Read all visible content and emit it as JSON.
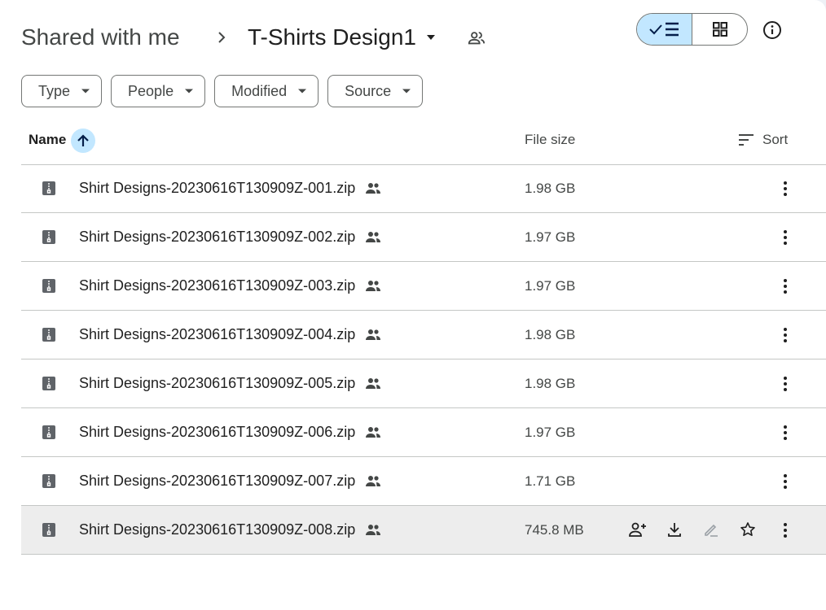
{
  "breadcrumb": {
    "root": "Shared with me",
    "current": "T-Shirts Design1"
  },
  "filters": [
    {
      "label": "Type"
    },
    {
      "label": "People"
    },
    {
      "label": "Modified"
    },
    {
      "label": "Source"
    }
  ],
  "table": {
    "headers": {
      "name": "Name",
      "size": "File size",
      "sort": "Sort"
    },
    "rows": [
      {
        "name": "Shirt Designs-20230616T130909Z-001.zip",
        "size": "1.98 GB"
      },
      {
        "name": "Shirt Designs-20230616T130909Z-002.zip",
        "size": "1.97 GB"
      },
      {
        "name": "Shirt Designs-20230616T130909Z-003.zip",
        "size": "1.97 GB"
      },
      {
        "name": "Shirt Designs-20230616T130909Z-004.zip",
        "size": "1.98 GB"
      },
      {
        "name": "Shirt Designs-20230616T130909Z-005.zip",
        "size": "1.98 GB"
      },
      {
        "name": "Shirt Designs-20230616T130909Z-006.zip",
        "size": "1.97 GB"
      },
      {
        "name": "Shirt Designs-20230616T130909Z-007.zip",
        "size": "1.71 GB"
      },
      {
        "name": "Shirt Designs-20230616T130909Z-008.zip",
        "size": "745.8 MB"
      }
    ]
  },
  "colors": {
    "accent": "#c2e7ff",
    "hover_row": "#ededed",
    "border": "#c4c7c5"
  },
  "icons": [
    "chevron-right-icon",
    "dropdown-caret-icon",
    "shared-people-icon",
    "list-view-icon",
    "grid-view-icon",
    "info-icon",
    "sort-arrow-up-icon",
    "sort-lines-icon",
    "zip-file-icon",
    "more-vert-icon",
    "add-person-icon",
    "download-icon",
    "rename-icon",
    "star-icon"
  ]
}
